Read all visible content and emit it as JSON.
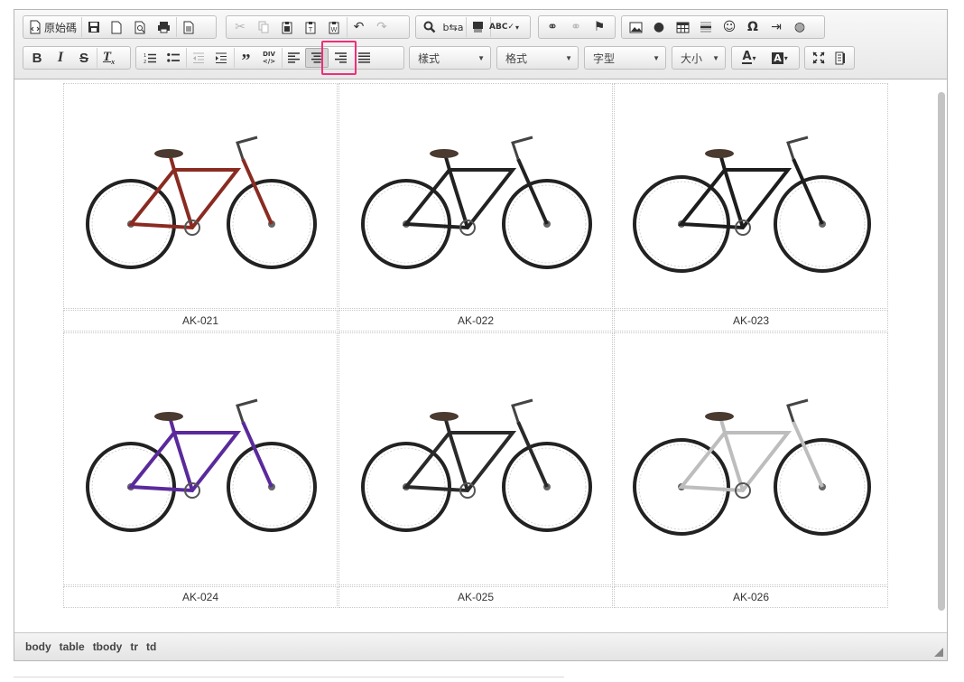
{
  "toolbar": {
    "source_label": "原始碼",
    "styles_label": "樣式",
    "format_label": "格式",
    "font_label": "字型",
    "size_label": "大小",
    "bold_label": "B",
    "italic_label": "I",
    "strike_label": "S",
    "active_button": "align-center"
  },
  "table": {
    "cells": [
      {
        "caption": "AK-021",
        "color": "#8a2b22"
      },
      {
        "caption": "AK-022",
        "color": "#222222"
      },
      {
        "caption": "AK-023",
        "color": "#1d1d1d"
      },
      {
        "caption": "AK-024",
        "color": "#5a2a9c"
      },
      {
        "caption": "AK-025",
        "color": "#2a2a2a"
      },
      {
        "caption": "AK-026",
        "color": "#bdbdbd"
      }
    ]
  },
  "statusbar": {
    "path": [
      "body",
      "table",
      "tbody",
      "tr",
      "td"
    ]
  },
  "colors": {
    "highlight": "#ef2e7a"
  }
}
